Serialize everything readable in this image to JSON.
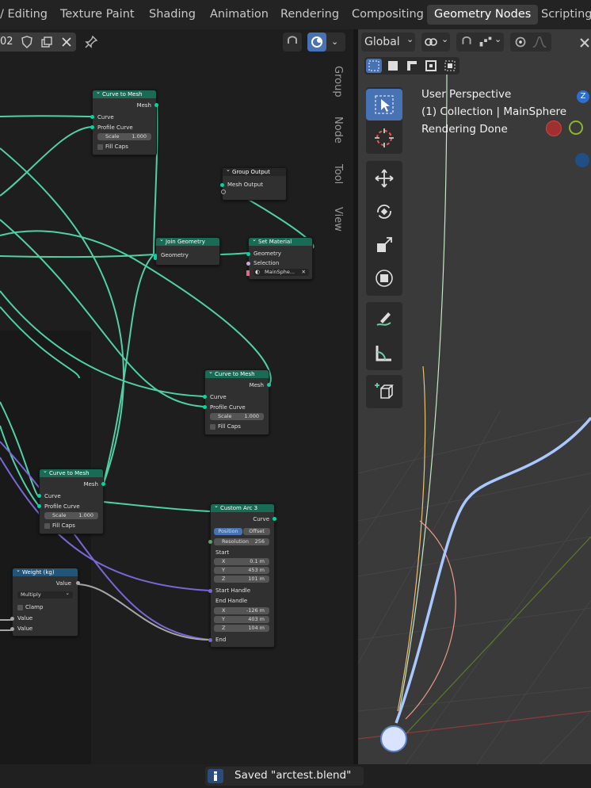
{
  "topbar": {
    "tabs": [
      "/ Editing",
      "Texture Paint",
      "Shading",
      "Animation",
      "Rendering",
      "Compositing",
      "Geometry Nodes",
      "Scripting"
    ],
    "active_tab": "Geometry Nodes"
  },
  "node_editor": {
    "datablock_label": "02",
    "side_tabs": [
      "Group",
      "Node",
      "Tool",
      "View"
    ],
    "nodes": {
      "ctm1": {
        "title": "Curve to Mesh",
        "out": "Mesh",
        "in1": "Curve",
        "in2": "Profile Curve",
        "scale_label": "Scale",
        "scale_value": "1.000",
        "fill": "Fill Caps"
      },
      "ctm2": {
        "title": "Curve to Mesh",
        "out": "Mesh",
        "in1": "Curve",
        "in2": "Profile Curve",
        "scale_label": "Scale",
        "scale_value": "1.000",
        "fill": "Fill Caps"
      },
      "ctm3": {
        "title": "Curve to Mesh",
        "out": "Mesh",
        "in1": "Curve",
        "in2": "Profile Curve",
        "scale_label": "Scale",
        "scale_value": "1.000",
        "fill": "Fill Caps"
      },
      "group_output": {
        "title": "Group Output",
        "in1": "Mesh Output"
      },
      "join": {
        "title": "Join Geometry",
        "in1": "Geometry"
      },
      "set_material": {
        "title": "Set Material",
        "in1": "Geometry",
        "in2": "Selection",
        "material": "MainSphe..."
      },
      "arc": {
        "title": "Custom Arc 3",
        "out": "Curve",
        "mode_a": "Position",
        "mode_b": "Offset",
        "res_label": "Resolution",
        "res_value": "256",
        "start": "Start",
        "sx_label": "X",
        "sx": "0.1 m",
        "sy_label": "Y",
        "sy": "453 m",
        "sz_label": "Z",
        "sz": "101 m",
        "start_handle": "Start Handle",
        "end_handle": "End Handle",
        "ex_label": "X",
        "ex": "-126 m",
        "ey_label": "Y",
        "ey": "403 m",
        "ez_label": "Z",
        "ez": "104 m",
        "end": "End"
      },
      "weight": {
        "title": "Weight (kg)",
        "out": "Value",
        "operation": "Multiply",
        "clamp": "Clamp",
        "in1": "Value",
        "in2": "Value"
      }
    }
  },
  "viewport": {
    "orientation": "Global",
    "overlay_lines": [
      "User Perspective",
      "(1) Collection | MainSphere",
      "Rendering Done"
    ],
    "gizmo_axis": "Z"
  },
  "statusbar": {
    "message": "Saved \"arctest.blend\""
  },
  "colors": {
    "geometry_socket": "#00d6a3",
    "node_header_green": "#1a6b55",
    "node_header_blue": "#22557a",
    "link_green": "#4fd1a5",
    "link_purple": "#7768d6",
    "link_gray": "#a6a6a6",
    "active_tab_bg": "#3d3d3d"
  }
}
